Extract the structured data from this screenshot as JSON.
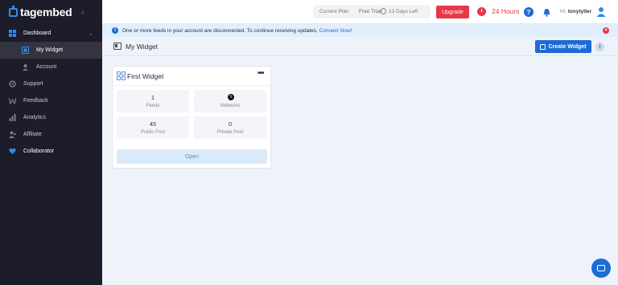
{
  "app": {
    "name": "tagembed"
  },
  "sidebar": {
    "items": [
      {
        "label": "Dashboard",
        "icon": "dashboard-icon"
      },
      {
        "label": "My Widget",
        "icon": "widget-icon"
      },
      {
        "label": "Account",
        "icon": "account-icon"
      },
      {
        "label": "Support",
        "icon": "support-icon"
      },
      {
        "label": "Feedback",
        "icon": "feedback-icon"
      },
      {
        "label": "Analytics",
        "icon": "analytics-icon"
      },
      {
        "label": "Affiliate",
        "icon": "affiliate-icon"
      },
      {
        "label": "Collaborator",
        "icon": "collaborator-icon"
      }
    ]
  },
  "topbar": {
    "current_plan_label": "Current Plan",
    "plan_name": "Free Trial",
    "days_left": "13 Days Left",
    "upgrade_label": "Upgrade",
    "hours": "24 Hours",
    "help": "?",
    "greeting": "Hi,",
    "username": "tonytyller"
  },
  "alert": {
    "message": "One or more feeds in your account are disconnected. To continue receiving updates,",
    "link": "Connect Now!",
    "info_glyph": "!",
    "close_glyph": "×"
  },
  "page": {
    "title": "My Widget",
    "create_label": "Create Widget",
    "info_glyph": "i"
  },
  "widget": {
    "title": "First Widget",
    "menu_glyph": "•••",
    "stats": {
      "feeds": {
        "value": "1",
        "label": "Feeds"
      },
      "networks": {
        "label": "Networks",
        "icon_glyph": "𝕏"
      },
      "public_post": {
        "value": "45",
        "label": "Public Post"
      },
      "private_post": {
        "value": "0",
        "label": "Private Post"
      }
    },
    "open_label": "Open"
  },
  "colors": {
    "accent": "#1d6bd6",
    "danger": "#e8364a",
    "sidebar_bg": "#1c1c2b"
  }
}
